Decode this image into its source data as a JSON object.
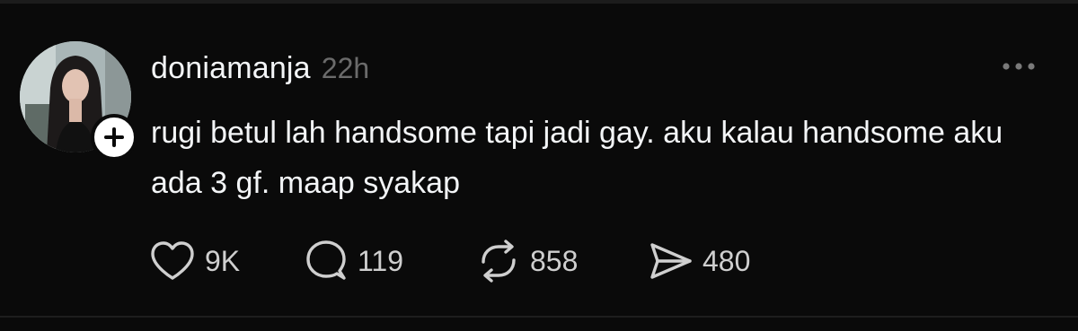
{
  "post": {
    "username": "doniamanja",
    "timestamp": "22h",
    "text": "rugi betul lah handsome tapi jadi gay. aku kalau handsome aku ada 3 gf. maap syakap",
    "actions": {
      "like": {
        "icon": "heart-icon",
        "count": "9K"
      },
      "reply": {
        "icon": "comment-icon",
        "count": "119"
      },
      "repost": {
        "icon": "repost-icon",
        "count": "858"
      },
      "share": {
        "icon": "send-icon",
        "count": "480"
      }
    }
  },
  "icons": {
    "avatar": "profile-photo",
    "follow": "plus-icon",
    "more": "ellipsis-icon"
  },
  "colors": {
    "background": "#0a0a0a",
    "text": "#f3f5f7",
    "muted": "#6b6b6b",
    "icon": "#cfcfcf"
  }
}
